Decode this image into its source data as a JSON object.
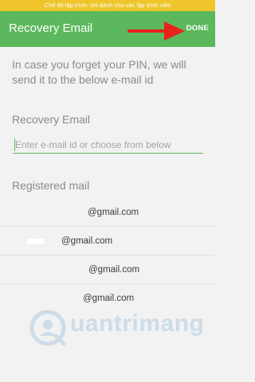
{
  "status_bar": {
    "text": "Chế độ lập trình: chỉ dành cho các lập trình viên"
  },
  "app_bar": {
    "title": "Recovery Email",
    "done_label": "DONE"
  },
  "intro_text": "In case you forget your PIN, we will send it to the below e-mail id",
  "recovery_section": {
    "label": "Recovery Email",
    "input_placeholder": "Enter e-mail id or choose from below",
    "input_value": ""
  },
  "registered_section": {
    "label": "Registered mail",
    "emails": [
      "@gmail.com",
      "@gmail.com",
      "@gmail.com",
      "@gmail.com"
    ]
  },
  "watermark": {
    "text": "uantrimang"
  },
  "colors": {
    "accent": "#5cb85c",
    "status_bar": "#efc52b",
    "arrow": "#e8231c"
  }
}
